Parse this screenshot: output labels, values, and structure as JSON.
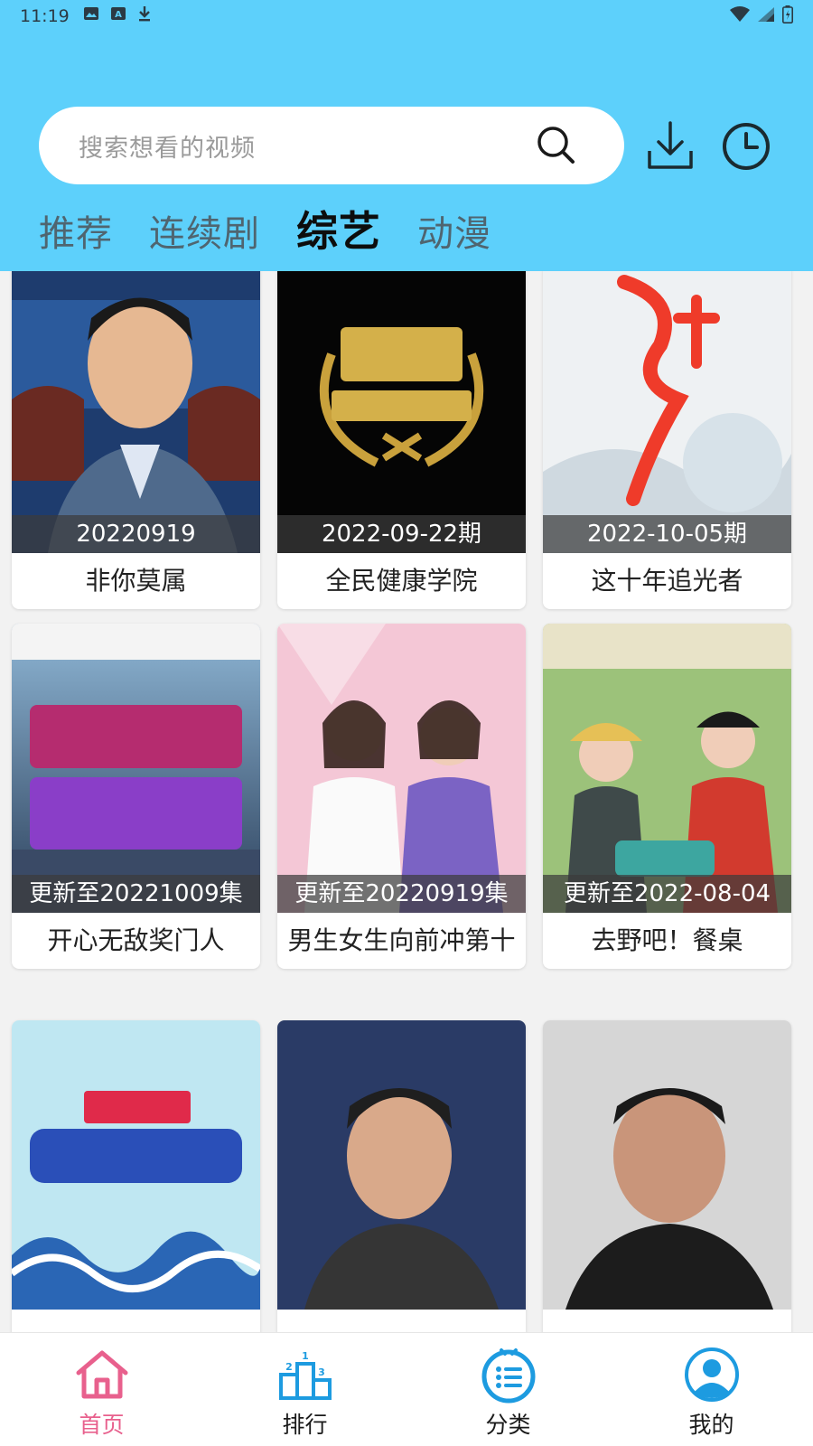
{
  "status_bar": {
    "time": "11:19"
  },
  "search": {
    "placeholder": "搜索想看的视频"
  },
  "tabs": [
    {
      "label": "推荐",
      "active": false
    },
    {
      "label": "连续剧",
      "active": false
    },
    {
      "label": "综艺",
      "active": true
    },
    {
      "label": "动漫",
      "active": false
    }
  ],
  "videos": [
    {
      "title": "非你莫属",
      "badge": "20220919"
    },
    {
      "title": "全民健康学院",
      "badge": "2022-09-22期"
    },
    {
      "title": "这十年追光者",
      "badge": "2022-10-05期"
    },
    {
      "title": "开心无敌奖门人",
      "badge": "更新至20221009集"
    },
    {
      "title": "男生女生向前冲第十",
      "badge": "更新至20220919集"
    },
    {
      "title": "去野吧！餐桌",
      "badge": "更新至2022-08-04"
    },
    {
      "title": "",
      "badge": ""
    },
    {
      "title": "",
      "badge": ""
    },
    {
      "title": "",
      "badge": ""
    }
  ],
  "bottom_nav": [
    {
      "label": "首页",
      "icon": "home-icon",
      "active": true
    },
    {
      "label": "排行",
      "icon": "podium-icon",
      "active": false
    },
    {
      "label": "分类",
      "icon": "category-icon",
      "active": false
    },
    {
      "label": "我的",
      "icon": "profile-icon",
      "active": false
    }
  ],
  "colors": {
    "header_bg": "#5dd0fb",
    "active_nav": "#e8608d",
    "nav_icon_blue": "#1d9be0"
  }
}
